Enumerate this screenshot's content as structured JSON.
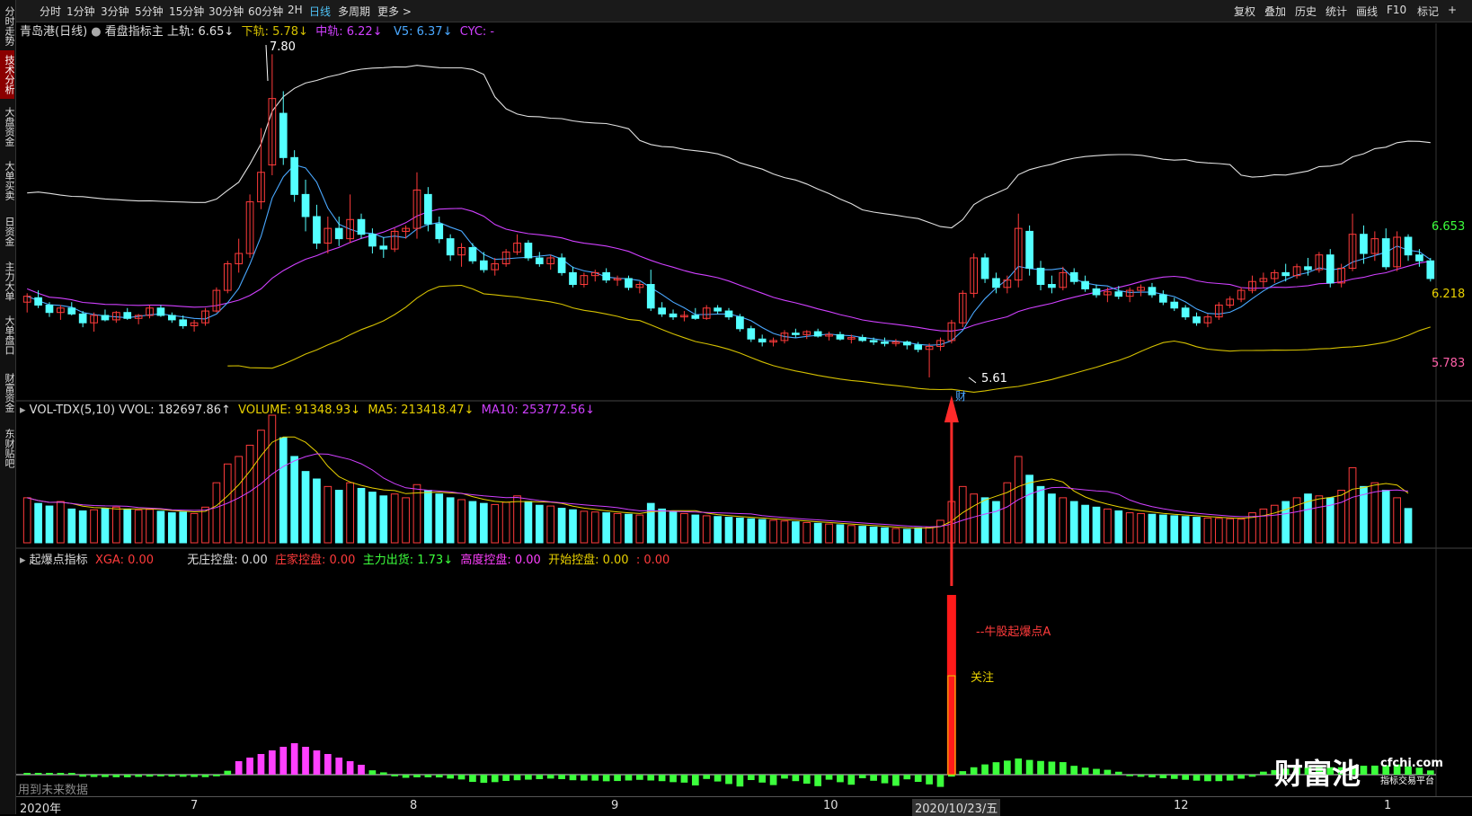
{
  "sidebar": {
    "tabs": [
      {
        "label": "分时走势",
        "active": false
      },
      {
        "label": "技术分析",
        "active": true
      },
      {
        "label": "大盘资金",
        "active": false
      },
      {
        "label": "大单买卖",
        "active": false
      },
      {
        "label": "日资金",
        "active": false
      },
      {
        "label": "主力大单",
        "active": false
      },
      {
        "label": "大单盘口",
        "active": false
      },
      {
        "label": "财富资金",
        "active": false
      },
      {
        "label": "东财贴吧",
        "active": false
      }
    ]
  },
  "toolbar": {
    "periods": [
      "分时",
      "1分钟",
      "3分钟",
      "5分钟",
      "15分钟",
      "30分钟",
      "60分钟",
      "2H",
      "日线",
      "多周期",
      "更多 >"
    ],
    "active_period": "日线",
    "right": [
      "复权",
      "叠加",
      "历史",
      "统计",
      "画线",
      "F10",
      "标记",
      "+"
    ]
  },
  "main_legend": {
    "stock": "青岛港(日线)",
    "indicator": "看盘指标主",
    "upper": "上轨: 6.65↓",
    "lower": "下轨: 5.78↓",
    "mid": "中轨: 6.22↓",
    "v5": "V5: 6.37↓",
    "cyc": "CYC: -"
  },
  "price_labels": {
    "high": "7.80",
    "low": "5.61",
    "right_upper": "6.653",
    "right_mid": "6.218",
    "right_lower": "5.783",
    "event_mark": "财"
  },
  "vol_legend": {
    "name": "VOL-TDX(5,10) VVOL: 182697.86↑",
    "volume": "VOLUME: 91348.93↓",
    "ma5": "MA5: 213418.47↓",
    "ma10": "MA10: 253772.56↓"
  },
  "ind_legend": {
    "name": "起爆点指标",
    "xga": "XGA: 0.00",
    "wz": "无庄控盘: 0.00",
    "zj": "庄家控盘: 0.00",
    "zl": "主力出货: 1.73↓",
    "gd": "高度控盘: 0.00",
    "ks": "开始控盘: 0.00",
    "extra": ": 0.00"
  },
  "annotations": {
    "signal": "--牛股起爆点A",
    "focus": "关注",
    "future_data": "用到未来数据"
  },
  "time_axis": {
    "labels": [
      "2020年",
      "7",
      "8",
      "9",
      "10",
      "2020/10/23/五",
      "12",
      "1"
    ]
  },
  "logo": {
    "text": "财富池",
    "site": "cfchi.com",
    "tagline": "指标交易平台"
  },
  "colors": {
    "up": "#ff3b3b",
    "down": "#54ffff",
    "upper_band": "#e0e0e0",
    "mid_band": "#d040ff",
    "lower_band": "#d4c000",
    "v5": "#4aa8ff",
    "ma5_vol": "#e8d000",
    "ma10_vol": "#d040ff"
  },
  "chart_data": {
    "type": "candlestick",
    "title": "青岛港(日线)",
    "price_ylim": [
      5.5,
      7.9
    ],
    "candles": [
      {
        "o": 6.12,
        "h": 6.18,
        "l": 6.05,
        "c": 6.16
      },
      {
        "o": 6.15,
        "h": 6.2,
        "l": 6.08,
        "c": 6.1
      },
      {
        "o": 6.1,
        "h": 6.12,
        "l": 6.02,
        "c": 6.05
      },
      {
        "o": 6.05,
        "h": 6.1,
        "l": 6.0,
        "c": 6.08
      },
      {
        "o": 6.08,
        "h": 6.12,
        "l": 6.03,
        "c": 6.04
      },
      {
        "o": 6.04,
        "h": 6.06,
        "l": 5.95,
        "c": 5.98
      },
      {
        "o": 5.98,
        "h": 6.05,
        "l": 5.92,
        "c": 6.03
      },
      {
        "o": 6.03,
        "h": 6.07,
        "l": 5.99,
        "c": 6.0
      },
      {
        "o": 6.0,
        "h": 6.06,
        "l": 5.98,
        "c": 6.05
      },
      {
        "o": 6.05,
        "h": 6.08,
        "l": 6.0,
        "c": 6.01
      },
      {
        "o": 6.01,
        "h": 6.04,
        "l": 5.97,
        "c": 6.03
      },
      {
        "o": 6.03,
        "h": 6.1,
        "l": 6.01,
        "c": 6.08
      },
      {
        "o": 6.08,
        "h": 6.1,
        "l": 6.02,
        "c": 6.03
      },
      {
        "o": 6.03,
        "h": 6.05,
        "l": 5.98,
        "c": 6.0
      },
      {
        "o": 6.0,
        "h": 6.03,
        "l": 5.94,
        "c": 5.96
      },
      {
        "o": 5.96,
        "h": 6.0,
        "l": 5.92,
        "c": 5.98
      },
      {
        "o": 5.98,
        "h": 6.08,
        "l": 5.96,
        "c": 6.06
      },
      {
        "o": 6.06,
        "h": 6.22,
        "l": 6.05,
        "c": 6.2
      },
      {
        "o": 6.2,
        "h": 6.4,
        "l": 6.18,
        "c": 6.38
      },
      {
        "o": 6.38,
        "h": 6.55,
        "l": 6.32,
        "c": 6.45
      },
      {
        "o": 6.45,
        "h": 6.85,
        "l": 6.42,
        "c": 6.8
      },
      {
        "o": 6.8,
        "h": 7.3,
        "l": 6.75,
        "c": 7.0
      },
      {
        "o": 7.05,
        "h": 7.8,
        "l": 6.98,
        "c": 7.5
      },
      {
        "o": 7.4,
        "h": 7.55,
        "l": 7.05,
        "c": 7.1
      },
      {
        "o": 7.1,
        "h": 7.15,
        "l": 6.8,
        "c": 6.85
      },
      {
        "o": 6.85,
        "h": 6.95,
        "l": 6.6,
        "c": 6.7
      },
      {
        "o": 6.7,
        "h": 6.78,
        "l": 6.48,
        "c": 6.52
      },
      {
        "o": 6.52,
        "h": 6.7,
        "l": 6.45,
        "c": 6.62
      },
      {
        "o": 6.62,
        "h": 6.7,
        "l": 6.5,
        "c": 6.55
      },
      {
        "o": 6.55,
        "h": 6.85,
        "l": 6.52,
        "c": 6.68
      },
      {
        "o": 6.68,
        "h": 6.72,
        "l": 6.55,
        "c": 6.58
      },
      {
        "o": 6.58,
        "h": 6.62,
        "l": 6.45,
        "c": 6.5
      },
      {
        "o": 6.5,
        "h": 6.56,
        "l": 6.42,
        "c": 6.48
      },
      {
        "o": 6.48,
        "h": 6.62,
        "l": 6.46,
        "c": 6.6
      },
      {
        "o": 6.6,
        "h": 6.64,
        "l": 6.55,
        "c": 6.62
      },
      {
        "o": 6.62,
        "h": 7.0,
        "l": 6.55,
        "c": 6.88
      },
      {
        "o": 6.85,
        "h": 6.9,
        "l": 6.6,
        "c": 6.65
      },
      {
        "o": 6.65,
        "h": 6.7,
        "l": 6.52,
        "c": 6.55
      },
      {
        "o": 6.55,
        "h": 6.58,
        "l": 6.4,
        "c": 6.44
      },
      {
        "o": 6.44,
        "h": 6.52,
        "l": 6.36,
        "c": 6.49
      },
      {
        "o": 6.49,
        "h": 6.52,
        "l": 6.38,
        "c": 6.4
      },
      {
        "o": 6.4,
        "h": 6.46,
        "l": 6.32,
        "c": 6.34
      },
      {
        "o": 6.34,
        "h": 6.42,
        "l": 6.3,
        "c": 6.38
      },
      {
        "o": 6.38,
        "h": 6.48,
        "l": 6.36,
        "c": 6.46
      },
      {
        "o": 6.46,
        "h": 6.58,
        "l": 6.44,
        "c": 6.52
      },
      {
        "o": 6.52,
        "h": 6.54,
        "l": 6.4,
        "c": 6.42
      },
      {
        "o": 6.42,
        "h": 6.46,
        "l": 6.36,
        "c": 6.38
      },
      {
        "o": 6.38,
        "h": 6.44,
        "l": 6.34,
        "c": 6.42
      },
      {
        "o": 6.42,
        "h": 6.45,
        "l": 6.3,
        "c": 6.32
      },
      {
        "o": 6.32,
        "h": 6.36,
        "l": 6.22,
        "c": 6.24
      },
      {
        "o": 6.24,
        "h": 6.32,
        "l": 6.22,
        "c": 6.3
      },
      {
        "o": 6.3,
        "h": 6.34,
        "l": 6.26,
        "c": 6.32
      },
      {
        "o": 6.32,
        "h": 6.35,
        "l": 6.25,
        "c": 6.27
      },
      {
        "o": 6.27,
        "h": 6.3,
        "l": 6.23,
        "c": 6.28
      },
      {
        "o": 6.28,
        "h": 6.3,
        "l": 6.2,
        "c": 6.22
      },
      {
        "o": 6.22,
        "h": 6.26,
        "l": 6.18,
        "c": 6.24
      },
      {
        "o": 6.24,
        "h": 6.34,
        "l": 6.06,
        "c": 6.08
      },
      {
        "o": 6.08,
        "h": 6.12,
        "l": 6.02,
        "c": 6.04
      },
      {
        "o": 6.04,
        "h": 6.07,
        "l": 6.0,
        "c": 6.02
      },
      {
        "o": 6.02,
        "h": 6.06,
        "l": 5.99,
        "c": 6.03
      },
      {
        "o": 6.03,
        "h": 6.08,
        "l": 6.0,
        "c": 6.01
      },
      {
        "o": 6.01,
        "h": 6.1,
        "l": 6.0,
        "c": 6.08
      },
      {
        "o": 6.08,
        "h": 6.1,
        "l": 6.04,
        "c": 6.06
      },
      {
        "o": 6.06,
        "h": 6.08,
        "l": 6.0,
        "c": 6.02
      },
      {
        "o": 6.02,
        "h": 6.04,
        "l": 5.92,
        "c": 5.94
      },
      {
        "o": 5.94,
        "h": 5.96,
        "l": 5.85,
        "c": 5.87
      },
      {
        "o": 5.87,
        "h": 5.9,
        "l": 5.82,
        "c": 5.85
      },
      {
        "o": 5.85,
        "h": 5.88,
        "l": 5.82,
        "c": 5.86
      },
      {
        "o": 5.86,
        "h": 5.93,
        "l": 5.84,
        "c": 5.91
      },
      {
        "o": 5.91,
        "h": 5.94,
        "l": 5.88,
        "c": 5.9
      },
      {
        "o": 5.9,
        "h": 5.93,
        "l": 5.87,
        "c": 5.92
      },
      {
        "o": 5.92,
        "h": 5.94,
        "l": 5.88,
        "c": 5.89
      },
      {
        "o": 5.89,
        "h": 5.92,
        "l": 5.86,
        "c": 5.9
      },
      {
        "o": 5.9,
        "h": 5.92,
        "l": 5.86,
        "c": 5.87
      },
      {
        "o": 5.87,
        "h": 5.9,
        "l": 5.84,
        "c": 5.88
      },
      {
        "o": 5.88,
        "h": 5.9,
        "l": 5.85,
        "c": 5.86
      },
      {
        "o": 5.86,
        "h": 5.88,
        "l": 5.83,
        "c": 5.85
      },
      {
        "o": 5.85,
        "h": 5.88,
        "l": 5.82,
        "c": 5.84
      },
      {
        "o": 5.84,
        "h": 5.87,
        "l": 5.82,
        "c": 5.85
      },
      {
        "o": 5.85,
        "h": 5.86,
        "l": 5.8,
        "c": 5.83
      },
      {
        "o": 5.83,
        "h": 5.85,
        "l": 5.78,
        "c": 5.8
      },
      {
        "o": 5.8,
        "h": 5.84,
        "l": 5.61,
        "c": 5.82
      },
      {
        "o": 5.82,
        "h": 5.88,
        "l": 5.79,
        "c": 5.86
      },
      {
        "o": 5.86,
        "h": 6.0,
        "l": 5.84,
        "c": 5.98
      },
      {
        "o": 5.98,
        "h": 6.2,
        "l": 5.95,
        "c": 6.18
      },
      {
        "o": 6.18,
        "h": 6.45,
        "l": 6.15,
        "c": 6.42
      },
      {
        "o": 6.42,
        "h": 6.45,
        "l": 6.25,
        "c": 6.28
      },
      {
        "o": 6.28,
        "h": 6.32,
        "l": 6.18,
        "c": 6.22
      },
      {
        "o": 6.22,
        "h": 6.3,
        "l": 6.18,
        "c": 6.27
      },
      {
        "o": 6.27,
        "h": 6.72,
        "l": 6.22,
        "c": 6.62
      },
      {
        "o": 6.6,
        "h": 6.64,
        "l": 6.3,
        "c": 6.35
      },
      {
        "o": 6.35,
        "h": 6.4,
        "l": 6.2,
        "c": 6.24
      },
      {
        "o": 6.24,
        "h": 6.3,
        "l": 6.18,
        "c": 6.22
      },
      {
        "o": 6.22,
        "h": 6.36,
        "l": 6.2,
        "c": 6.32
      },
      {
        "o": 6.32,
        "h": 6.35,
        "l": 6.24,
        "c": 6.26
      },
      {
        "o": 6.26,
        "h": 6.3,
        "l": 6.19,
        "c": 6.21
      },
      {
        "o": 6.21,
        "h": 6.24,
        "l": 6.15,
        "c": 6.17
      },
      {
        "o": 6.17,
        "h": 6.22,
        "l": 6.12,
        "c": 6.19
      },
      {
        "o": 6.19,
        "h": 6.23,
        "l": 6.14,
        "c": 6.16
      },
      {
        "o": 6.16,
        "h": 6.22,
        "l": 6.12,
        "c": 6.2
      },
      {
        "o": 6.2,
        "h": 6.24,
        "l": 6.16,
        "c": 6.22
      },
      {
        "o": 6.22,
        "h": 6.25,
        "l": 6.15,
        "c": 6.17
      },
      {
        "o": 6.17,
        "h": 6.2,
        "l": 6.1,
        "c": 6.12
      },
      {
        "o": 6.12,
        "h": 6.15,
        "l": 6.06,
        "c": 6.08
      },
      {
        "o": 6.08,
        "h": 6.1,
        "l": 6.0,
        "c": 6.02
      },
      {
        "o": 6.02,
        "h": 6.05,
        "l": 5.96,
        "c": 5.98
      },
      {
        "o": 5.98,
        "h": 6.04,
        "l": 5.95,
        "c": 6.02
      },
      {
        "o": 6.02,
        "h": 6.12,
        "l": 6.0,
        "c": 6.1
      },
      {
        "o": 6.1,
        "h": 6.16,
        "l": 6.08,
        "c": 6.14
      },
      {
        "o": 6.14,
        "h": 6.22,
        "l": 6.12,
        "c": 6.2
      },
      {
        "o": 6.2,
        "h": 6.3,
        "l": 6.18,
        "c": 6.26
      },
      {
        "o": 6.26,
        "h": 6.32,
        "l": 6.22,
        "c": 6.28
      },
      {
        "o": 6.28,
        "h": 6.34,
        "l": 6.25,
        "c": 6.32
      },
      {
        "o": 6.32,
        "h": 6.38,
        "l": 6.26,
        "c": 6.3
      },
      {
        "o": 6.3,
        "h": 6.38,
        "l": 6.28,
        "c": 6.36
      },
      {
        "o": 6.36,
        "h": 6.42,
        "l": 6.3,
        "c": 6.34
      },
      {
        "o": 6.34,
        "h": 6.46,
        "l": 6.32,
        "c": 6.44
      },
      {
        "o": 6.44,
        "h": 6.48,
        "l": 6.22,
        "c": 6.25
      },
      {
        "o": 6.25,
        "h": 6.38,
        "l": 6.22,
        "c": 6.35
      },
      {
        "o": 6.35,
        "h": 6.72,
        "l": 6.33,
        "c": 6.58
      },
      {
        "o": 6.58,
        "h": 6.64,
        "l": 6.38,
        "c": 6.45
      },
      {
        "o": 6.45,
        "h": 6.6,
        "l": 6.4,
        "c": 6.55
      },
      {
        "o": 6.55,
        "h": 6.62,
        "l": 6.34,
        "c": 6.36
      },
      {
        "o": 6.36,
        "h": 6.6,
        "l": 6.33,
        "c": 6.56
      },
      {
        "o": 6.56,
        "h": 6.58,
        "l": 6.4,
        "c": 6.44
      },
      {
        "o": 6.44,
        "h": 6.48,
        "l": 6.36,
        "c": 6.4
      },
      {
        "o": 6.4,
        "h": 6.42,
        "l": 6.26,
        "c": 6.28
      }
    ],
    "volume": [
      120000,
      105000,
      98000,
      110000,
      90000,
      85000,
      88000,
      92000,
      95000,
      90000,
      87000,
      89000,
      84000,
      80000,
      82000,
      78000,
      95000,
      160000,
      210000,
      230000,
      260000,
      300000,
      340000,
      280000,
      230000,
      190000,
      170000,
      150000,
      140000,
      160000,
      145000,
      135000,
      125000,
      130000,
      120000,
      155000,
      140000,
      130000,
      120000,
      115000,
      110000,
      105000,
      102000,
      108000,
      125000,
      110000,
      100000,
      98000,
      92000,
      88000,
      84000,
      82000,
      80000,
      78000,
      76000,
      74000,
      105000,
      90000,
      82000,
      78000,
      74000,
      72000,
      70000,
      68000,
      66000,
      64000,
      62000,
      60000,
      58000,
      56000,
      54000,
      52000,
      50000,
      48000,
      46000,
      44000,
      42000,
      40000,
      38000,
      36000,
      40000,
      42000,
      60000,
      110000,
      150000,
      130000,
      120000,
      110000,
      160000,
      230000,
      180000,
      150000,
      130000,
      120000,
      110000,
      100000,
      95000,
      90000,
      85000,
      80000,
      78000,
      76000,
      74000,
      72000,
      70000,
      68000,
      66000,
      65000,
      64000,
      63000,
      80000,
      90000,
      100000,
      110000,
      120000,
      130000,
      125000,
      120000,
      140000,
      200000,
      150000,
      160000,
      140000,
      120000,
      91348
    ],
    "ind_red_spike": {
      "index": 83,
      "value": 200
    },
    "event": {
      "date": "2020/10/23/五",
      "label": "财"
    }
  }
}
